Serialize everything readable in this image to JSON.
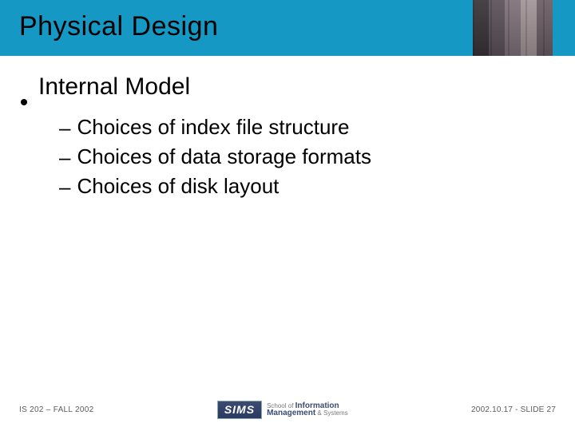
{
  "title": "Physical Design",
  "heading": "Internal Model",
  "bullets": [
    "Choices of index file structure",
    "Choices of data storage formats",
    "Choices of disk layout"
  ],
  "footer": {
    "left": "IS 202 – FALL 2002",
    "right": "2002.10.17 - SLIDE 27",
    "logo_badge": "SIMS",
    "logo_line1a": "School of",
    "logo_line1b": "Information",
    "logo_line2a": "Management",
    "logo_line2b": "& Systems"
  }
}
